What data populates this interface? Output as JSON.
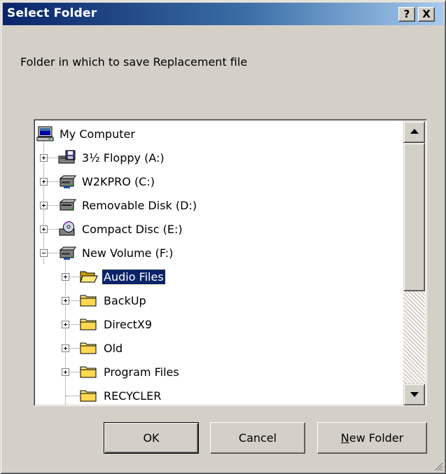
{
  "window": {
    "title": "Select Folder",
    "help_label": "?",
    "close_label": "X"
  },
  "prompt": "Folder in which to save Replacement file",
  "tree": {
    "items": [
      {
        "label": "My Computer",
        "icon": "computer-icon"
      },
      {
        "label": "3½ Floppy (A:)",
        "icon": "floppy-drive-icon"
      },
      {
        "label": "W2KPRO (C:)",
        "icon": "hard-drive-icon"
      },
      {
        "label": "Removable Disk (D:)",
        "icon": "removable-drive-icon"
      },
      {
        "label": "Compact Disc (E:)",
        "icon": "cd-drive-icon"
      },
      {
        "label": "New Volume (F:)",
        "icon": "hard-drive-icon"
      },
      {
        "label": "Audio Files",
        "icon": "open-folder-icon",
        "selected": true
      },
      {
        "label": "BackUp",
        "icon": "folder-icon"
      },
      {
        "label": "DirectX9",
        "icon": "folder-icon"
      },
      {
        "label": "Old",
        "icon": "folder-icon"
      },
      {
        "label": "Program Files",
        "icon": "folder-icon"
      },
      {
        "label": "RECYCLER",
        "icon": "folder-icon"
      }
    ]
  },
  "buttons": {
    "ok": "OK",
    "cancel": "Cancel",
    "new_folder_mnemonic": "N",
    "new_folder_rest": "ew Folder"
  },
  "colors": {
    "titlebar_start": "#0a246a",
    "titlebar_end": "#a6caf0",
    "selection": "#0a246a",
    "face": "#d4d0c8"
  }
}
